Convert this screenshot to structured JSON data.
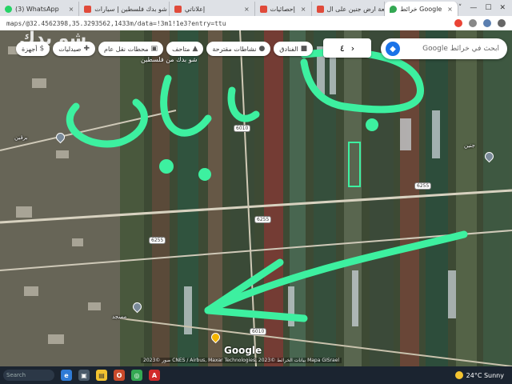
{
  "browser": {
    "tabs": [
      {
        "title": "(3) WhatsApp",
        "icon_color": "#25d366",
        "active": false
      },
      {
        "title": "شو بدك فلسطين | سيارات",
        "icon_color": "#e04a3a",
        "active": false
      },
      {
        "title": "إعلاناتي",
        "icon_color": "#e04a3a",
        "active": false
      },
      {
        "title": "إحصائيات",
        "icon_color": "#e04a3a",
        "active": false
      },
      {
        "title": "قطعة ارض جنين على ال",
        "icon_color": "#e04a3a",
        "active": false
      },
      {
        "title": "خرائط Google",
        "icon_color": "#34a853",
        "active": true
      }
    ],
    "tab_close_glyph": "×",
    "window_controls": [
      "˅",
      "—",
      "☐",
      "✕"
    ],
    "url": "maps/@32.4562398,35.3293562,1433m/data=!3m1!1e3?entry=ttu",
    "accent": "#1a73e8"
  },
  "map": {
    "search_placeholder": "ابحث في خرائط Google",
    "chips": [
      {
        "label": "الفنادق",
        "icon": "hotel-icon"
      },
      {
        "label": "نشاطات مقترحة",
        "icon": "camera-icon"
      },
      {
        "label": "متاحف",
        "icon": "museum-icon"
      },
      {
        "label": "محطات نقل عام",
        "icon": "bus-icon"
      },
      {
        "label": "صيدليات",
        "icon": "pharmacy-icon"
      },
      {
        "label": "أجهزة",
        "icon": "atm-icon"
      }
    ],
    "zoom_chip": {
      "value": "٤",
      "arrow": "›"
    },
    "watermark": "شو بدك",
    "watermark_sub": "شو بدك من فلسطين",
    "handwritten_label": "جنين",
    "road_badges": [
      "6010",
      "6255",
      "6255",
      "6255",
      "6010"
    ],
    "place_labels": [
      "برقين",
      "مسجد",
      "جنين"
    ],
    "google_logo": "Google",
    "attribution": "صور ©2023 CNES / Airbus, Maxar Technologies, بيانات الخرائط ©2023 Mapa GISrael",
    "stroke_color": "#3df0a0"
  },
  "taskbar": {
    "search": "Search",
    "apps": [
      {
        "label": "e",
        "color": "#2f7bd6",
        "icon": "edge-icon"
      },
      {
        "label": "▣",
        "color": "#4a5a6a",
        "icon": "taskview-icon"
      },
      {
        "label": "▤",
        "color": "#f2c230",
        "icon": "folder-icon"
      },
      {
        "label": "O",
        "color": "#c94a2b",
        "icon": "office-icon"
      },
      {
        "label": "◎",
        "color": "#34a853",
        "icon": "chrome-icon"
      },
      {
        "label": "A",
        "color": "#d12a2a",
        "icon": "acrobat-icon"
      }
    ],
    "weather": "24°C  Sunny"
  }
}
